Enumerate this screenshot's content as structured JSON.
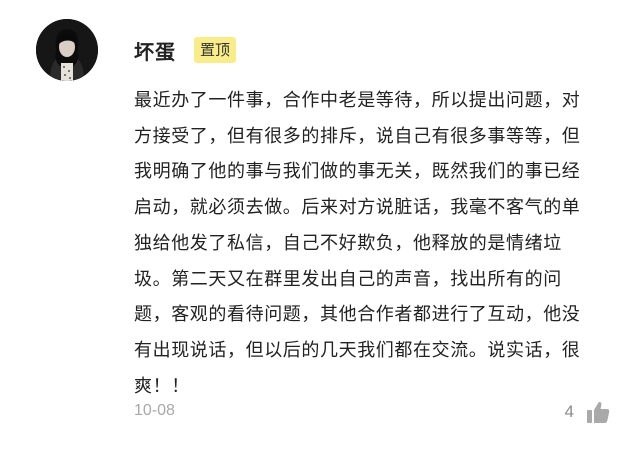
{
  "comment": {
    "username": "坏蛋",
    "badge": "置顶",
    "text": "最近办了一件事，合作中老是等待，所以提出问题，对方接受了，但有很多的排斥，说自己有很多事等等，但我明确了他的事与我们做的事无关，既然我们的事已经启动，就必须去做。后来对方说脏话，我毫不客气的单独给他发了私信，自己不好欺负，他释放的是情绪垃圾。第二天又在群里发出自己的声音，找出所有的问题，客观的看待问题，其他合作者都进行了互动，他没有出现说话，但以后的几天我们都在交流。说实话，很爽！！",
    "date": "10-08",
    "like_count": "4"
  },
  "icons": {
    "avatar": "user-avatar-photo",
    "like": "thumbs-up-icon"
  },
  "colors": {
    "badge_bg": "#f9ed8a",
    "text": "#222222",
    "meta": "#a8a8a8",
    "like_icon": "#a9a9a9"
  }
}
